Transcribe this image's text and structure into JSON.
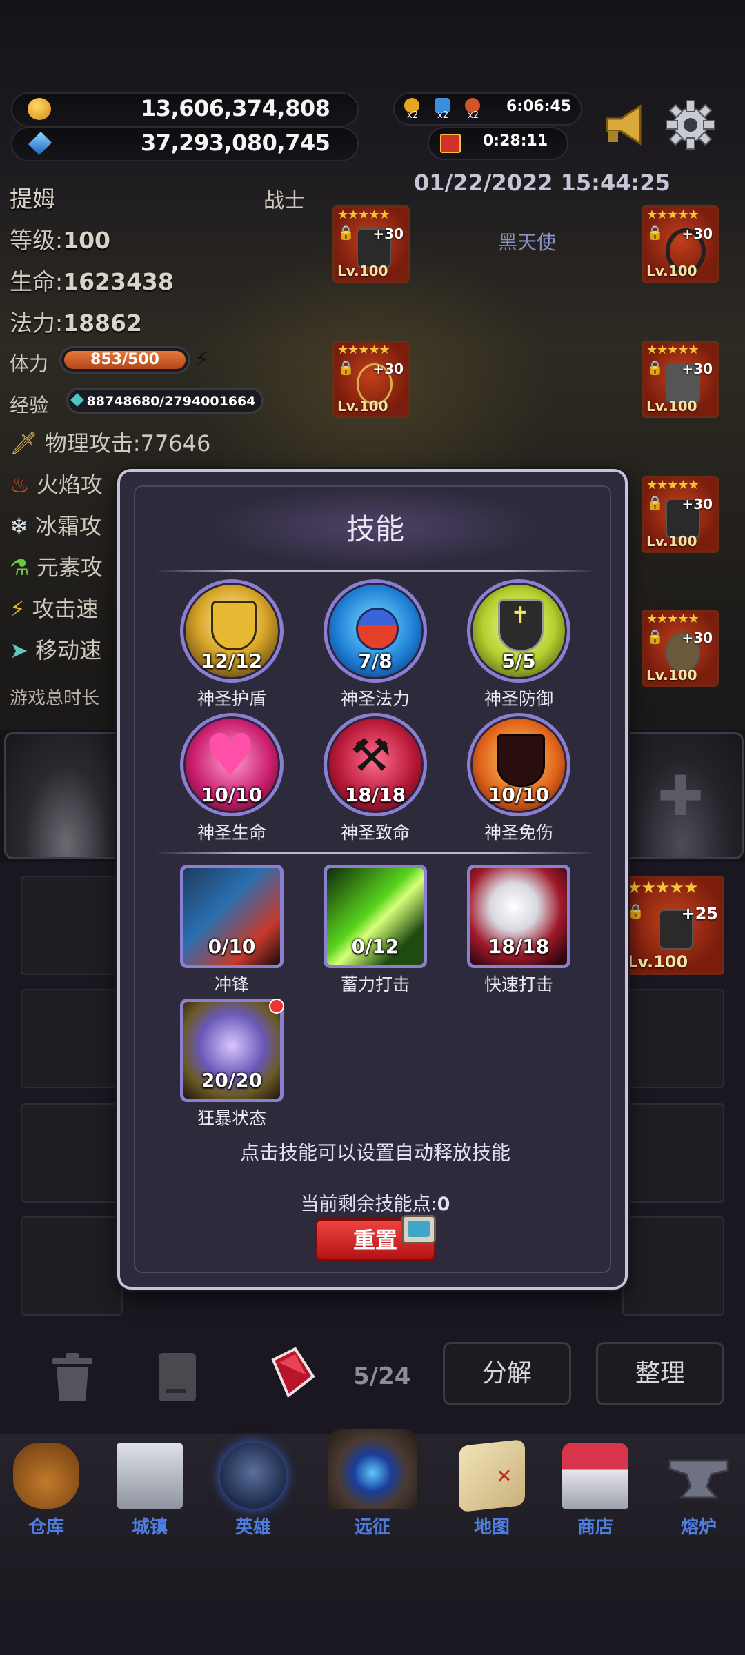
{
  "currencies": [
    {
      "icon": "gold-coin-icon",
      "value": "13,606,374,808"
    },
    {
      "icon": "blue-gem-icon",
      "value": "37,293,080,745"
    }
  ],
  "boosts": {
    "multipliers": [
      "x2",
      "x2",
      "x2"
    ],
    "boost_timer": "6:06:45",
    "gift_timer": "0:28:11"
  },
  "datetime": "01/22/2022 15:44:25",
  "hero": {
    "name": "提姆",
    "class": "战士",
    "title": "黑天使",
    "level_label": "等级:",
    "level": "100",
    "hp_label": "生命:",
    "hp": "1623438",
    "mp_label": "法力:",
    "mp": "18862",
    "stamina_label": "体力",
    "stamina": "853/500",
    "exp_label": "经验",
    "exp": "88748680/2794001664",
    "exp_fill": 0.03
  },
  "attributes": [
    {
      "icon": "sword-icon",
      "text": "物理攻击:77646"
    },
    {
      "icon": "fire-icon",
      "text": "火焰攻"
    },
    {
      "icon": "snowflake-icon",
      "text": "冰霜攻"
    },
    {
      "icon": "potion-icon",
      "text": "元素攻"
    },
    {
      "icon": "lightning-icon",
      "text": "攻击速"
    },
    {
      "icon": "boot-icon",
      "text": "移动速"
    }
  ],
  "playtime_label": "游戏总时长",
  "equipment": [
    {
      "stars": "★★★★★",
      "plus": "+30",
      "level": "Lv.100"
    },
    {
      "stars": "★★★★★",
      "plus": "+30",
      "level": "Lv.100"
    },
    {
      "stars": "★★★★★",
      "plus": "+30",
      "level": "Lv.100"
    },
    {
      "stars": "★★★★★",
      "plus": "+30",
      "level": "Lv.100"
    },
    {
      "stars": "★★★★★",
      "plus": "+30",
      "level": "Lv.100"
    },
    {
      "stars": "★★★★★",
      "plus": "+30",
      "level": "Lv.100"
    },
    {
      "stars": "★★★★★",
      "plus": "+25",
      "level": "Lv.100"
    }
  ],
  "skills_modal": {
    "title": "技能",
    "skills": [
      {
        "name": "神圣护盾",
        "count": "12/12",
        "icon": "lion-shield-icon"
      },
      {
        "name": "神圣法力",
        "count": "7/8",
        "icon": "mana-potion-icon"
      },
      {
        "name": "神圣防御",
        "count": "5/5",
        "icon": "cross-shield-icon"
      },
      {
        "name": "神圣生命",
        "count": "10/10",
        "icon": "heart-icon"
      },
      {
        "name": "神圣致命",
        "count": "18/18",
        "icon": "crossed-hammers-icon"
      },
      {
        "name": "神圣免伤",
        "count": "10/10",
        "icon": "dark-shield-icon"
      },
      {
        "name": "冲锋",
        "count": "0/10",
        "icon": "charge-knight-icon"
      },
      {
        "name": "蓄力打击",
        "count": "0/12",
        "icon": "green-slash-icon"
      },
      {
        "name": "快速打击",
        "count": "18/18",
        "icon": "swift-strike-icon"
      },
      {
        "name": "狂暴状态",
        "count": "20/20",
        "icon": "berserk-lion-icon"
      }
    ],
    "hint": "点击技能可以设置自动释放技能",
    "points_label": "当前剩余技能点:",
    "points_value": "0",
    "reset_label": "重置"
  },
  "inventory": {
    "count": "5/24",
    "decompose_label": "分解",
    "sort_label": "整理"
  },
  "nav": [
    {
      "label": "仓库",
      "icon": "bag-icon"
    },
    {
      "label": "城镇",
      "icon": "castle-icon"
    },
    {
      "label": "英雄",
      "icon": "helmet-icon"
    },
    {
      "label": "远征",
      "icon": "portal-icon"
    },
    {
      "label": "地图",
      "icon": "map-icon"
    },
    {
      "label": "商店",
      "icon": "shop-icon"
    },
    {
      "label": "熔炉",
      "icon": "anvil-icon"
    }
  ],
  "colors": {
    "modal_bg": "#2d2a3b",
    "orb_ring": "#8a7fd0",
    "nav_label": "#4f7de0",
    "reset_red": "#d42424"
  }
}
